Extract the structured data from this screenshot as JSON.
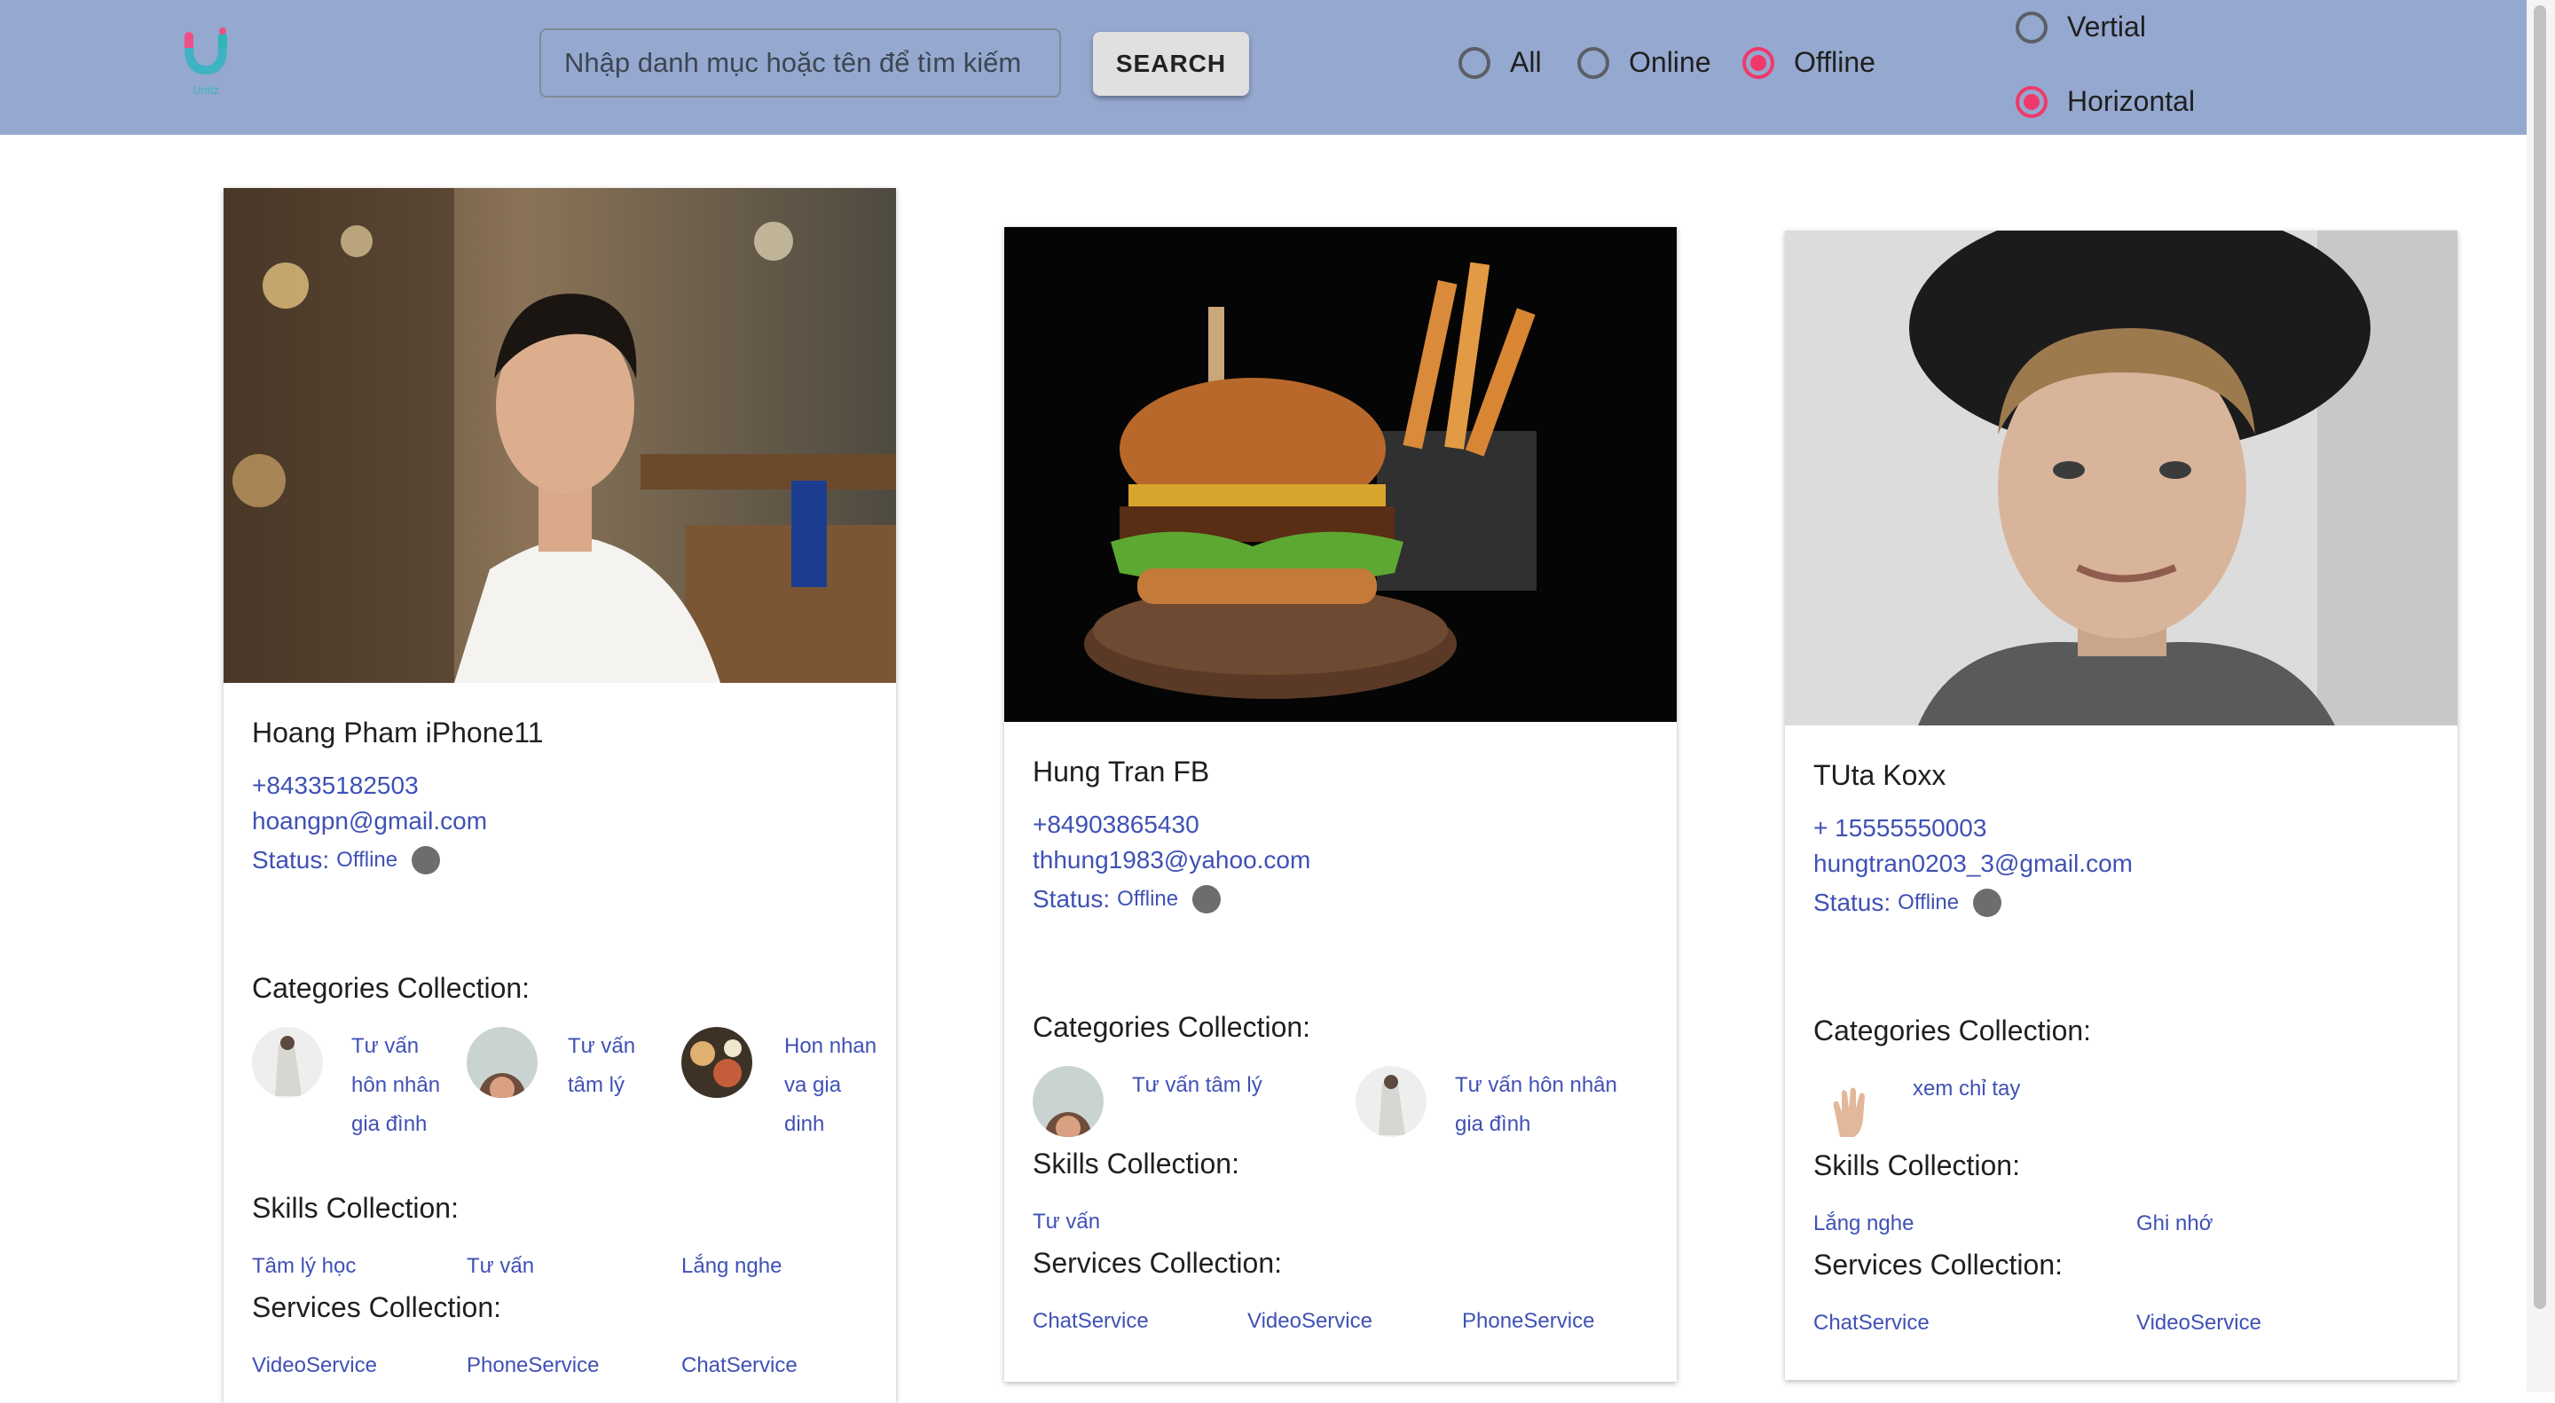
{
  "header": {
    "logo_text": "Unitz",
    "search_placeholder": "Nhập danh mục hoặc tên để tìm kiếm",
    "search_button": "SEARCH",
    "filters": [
      {
        "label": "All",
        "selected": false
      },
      {
        "label": "Online",
        "selected": false
      },
      {
        "label": "Offline",
        "selected": true
      }
    ],
    "layout": [
      {
        "label": "Vertial",
        "selected": false
      },
      {
        "label": "Horizontal",
        "selected": true
      }
    ]
  },
  "cards": [
    {
      "name": "Hoang Pham iPhone11",
      "phone": "+84335182503",
      "email": "hoangpn@gmail.com",
      "status_label": "Status:",
      "status_value": "Offline",
      "categories_title": "Categories Collection:",
      "categories": [
        "Tư vấn hôn nhân gia đình",
        "Tư vấn tâm lý",
        "Hon nhan va gia dinh"
      ],
      "skills_title": "Skills Collection:",
      "skills": [
        "Tâm lý học",
        "Tư vấn",
        "Lắng nghe"
      ],
      "services_title": "Services Collection:",
      "services": [
        "VideoService",
        "PhoneService",
        "ChatService"
      ]
    },
    {
      "name": "Hung Tran FB",
      "phone": "+84903865430",
      "email": "thhung1983@yahoo.com",
      "status_label": "Status:",
      "status_value": "Offline",
      "categories_title": "Categories Collection:",
      "categories": [
        "Tư vấn tâm lý",
        "Tư vấn hôn nhân gia đình"
      ],
      "skills_title": "Skills Collection:",
      "skills": [
        "Tư vấn"
      ],
      "services_title": "Services Collection:",
      "services": [
        "ChatService",
        "VideoService",
        "PhoneService"
      ]
    },
    {
      "name": "TUta Koxx",
      "phone": "+ 15555550003",
      "email": "hungtran0203_3@gmail.com",
      "status_label": "Status:",
      "status_value": "Offline",
      "categories_title": "Categories Collection:",
      "categories": [
        "xem chỉ tay"
      ],
      "skills_title": "Skills Collection:",
      "skills": [
        "Lắng nghe",
        "Ghi nhớ"
      ],
      "services_title": "Services Collection:",
      "services": [
        "ChatService",
        "VideoService"
      ]
    }
  ],
  "colors": {
    "header_bg": "#95a8cf",
    "accent": "#f0396a",
    "link": "#3f51b5",
    "offline_dot": "#6d6d6d"
  }
}
